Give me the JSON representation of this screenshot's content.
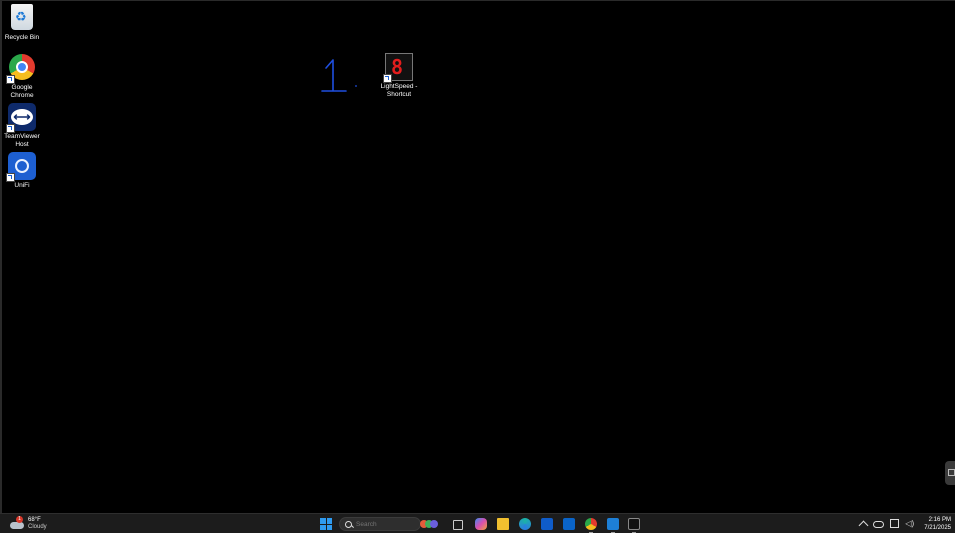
{
  "desktop": {
    "icons": [
      {
        "label": "Recycle Bin",
        "icon": "recycle-bin-icon"
      },
      {
        "label": "Google\nChrome",
        "icon": "chrome-icon",
        "shortcut": true
      },
      {
        "label": "TeamViewer\nHost",
        "icon": "teamviewer-icon",
        "shortcut": true
      },
      {
        "label": "UniFi",
        "icon": "unifi-icon",
        "shortcut": true
      },
      {
        "label": "LightSpeed -\nShortcut",
        "icon": "lightspeed-icon",
        "shortcut": true
      }
    ],
    "annotation_text": "1.",
    "annotation_color": "#1f4fe0"
  },
  "taskbar": {
    "weather": {
      "temp": "68°F",
      "condition": "Cloudy",
      "badge": "1"
    },
    "search": {
      "placeholder": "Search"
    },
    "apps": [
      {
        "icon": "start-windows-icon"
      },
      {
        "icon": "search-icon"
      },
      {
        "icon": "copilot-widget-icon"
      },
      {
        "icon": "task-view-icon"
      },
      {
        "icon": "copilot-icon"
      },
      {
        "icon": "file-explorer-icon"
      },
      {
        "icon": "edge-icon"
      },
      {
        "icon": "microsoft-store-icon"
      },
      {
        "icon": "outlook-icon"
      },
      {
        "icon": "chrome-icon"
      },
      {
        "icon": "remote-desktop-icon"
      },
      {
        "icon": "lightspeed-icon"
      }
    ],
    "tray": {
      "icons": [
        "chevron-up-icon",
        "onedrive-icon",
        "network-icon",
        "volume-icon"
      ],
      "time": "2:16 PM",
      "date": "7/21/2025"
    }
  },
  "colors": {
    "taskbar_bg": "#1c1c1c",
    "accent": "#2f9bf0",
    "lightspeed_red": "#e31d1d"
  }
}
